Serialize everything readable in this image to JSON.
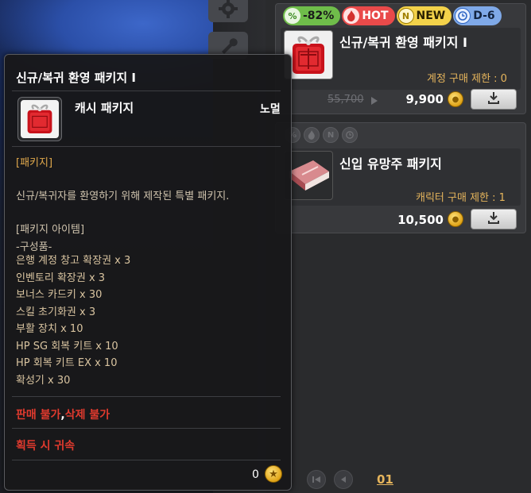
{
  "products": [
    {
      "tags": [
        {
          "type": "sale",
          "icon": "sale-percent-icon",
          "label": "-82%"
        },
        {
          "type": "hot",
          "icon": "flame-icon",
          "label": "HOT"
        },
        {
          "type": "new",
          "icon": "new-n-icon",
          "label": "NEW"
        },
        {
          "type": "deadline",
          "icon": "clock-icon",
          "label": "D-6"
        }
      ],
      "name": "신규/복귀 환영 패키지 I",
      "limit": "계정 구매 제한 : 0",
      "old_price": "55,700",
      "price": "9,900",
      "image": "red-gift-package"
    },
    {
      "tags_dim": [
        "sale-percent-icon",
        "flame-icon",
        "new-n-icon",
        "clock-icon"
      ],
      "name": "신입 유망주 패키지",
      "limit": "캐릭터 구매 제한 : 1",
      "price": "10,500",
      "image": "pink-book-package"
    }
  ],
  "pagination": {
    "current_page": "01"
  },
  "tooltip": {
    "title": "신규/복귀 환영 패키지 I",
    "type": "캐시 패키지",
    "grade": "노멀",
    "section_label": "[패키지]",
    "description": "신규/복귀자를 환영하기 위해 제작된 특별 패키지.",
    "items_heading": "[패키지 아이템]",
    "contents_label": "-구성품-",
    "items": [
      "은행 계정 창고 확장권 x 3",
      "인벤토리 확장권 x 3",
      "보너스 카드키 x 30",
      "스킬 초기화권 x 3",
      "부활 장치 x 10",
      "HP SG 회복 키트 x 10",
      "HP 회복 키트 EX x 10",
      "확성기 x 30"
    ],
    "restriction_a": "판매 불가",
    "restriction_sep": ",",
    "restriction_b": "삭제 불가",
    "bind_notice": "획득 시 귀속",
    "currency_value": "0"
  },
  "colors": {
    "accent_gold": "#e6b55c",
    "warning_red": "#e03a2e",
    "sale_green": "#6fbd4a",
    "hot_red": "#e94a4a",
    "new_yellow": "#f3d24a",
    "deadline_blue": "#7fa9e8"
  }
}
